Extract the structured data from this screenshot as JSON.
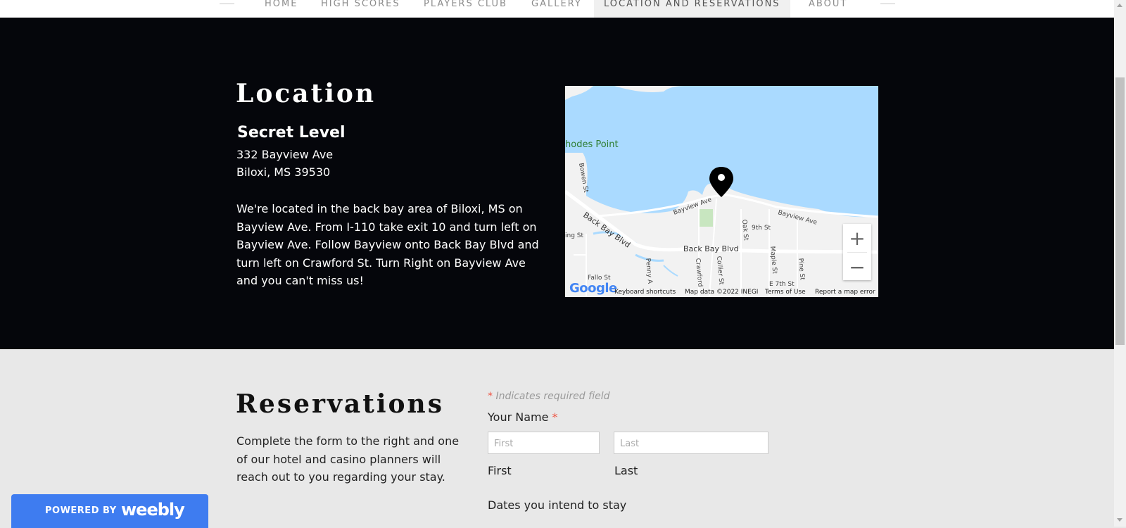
{
  "nav": {
    "items": [
      {
        "label": "HOME"
      },
      {
        "label": "HIGH SCORES"
      },
      {
        "label": "PLAYERS CLUB"
      },
      {
        "label": "GALLERY"
      },
      {
        "label": "LOCATION AND RESERVATIONS",
        "active": true
      },
      {
        "label": "ABOUT"
      }
    ]
  },
  "location": {
    "title": "Location",
    "venue": "Secret Level",
    "address_line1": "332 Bayview Ave",
    "address_line2": "Biloxi, MS 39530",
    "directions": "We're located in the back bay area of Biloxi, MS on Bayview Ave. From I-110 take exit 10 and turn left on Bayview Ave. Follow Bayview onto Back Bay Blvd and turn left on Crawford St. Turn Right on Bayview Ave and you can't miss us!"
  },
  "map": {
    "labels": {
      "rhodes_point": "hodes Point",
      "bowen_st": "Bowen St",
      "bayview_ave_1": "Bayview Ave",
      "bayview_ave_2": "Bayview Ave",
      "oak_st": "Oak St",
      "ninth_st": "9th St",
      "back_bay_blvd_1": "Back Bay Blvd",
      "back_bay_blvd_2": "Back Bay Blvd",
      "ing_st": "ing St",
      "maple_st": "Maple St",
      "pine_st": "Pine St",
      "fallo_st": "Fallo St",
      "penny_a": "Penny A",
      "crawford": "Crawford",
      "collier_st": "Collier St",
      "e7th_st": "E 7th St"
    },
    "zoom_in": "+",
    "zoom_out": "−",
    "google_logo": "Google",
    "attribution": {
      "keyboard": "Keyboard shortcuts",
      "mapdata": "Map data ©2022 INEGI",
      "terms": "Terms of Use",
      "report": "Report a map error"
    },
    "colors": {
      "water": "#aadaff",
      "land": "#f2f2f2",
      "park": "#c8e6c0"
    }
  },
  "reservations": {
    "title": "Reservations",
    "description": "Complete the form to the right and one of our hotel and casino planners will reach out to you regarding your stay.",
    "required_star": "*",
    "required_note": "Indicates required field",
    "name_label": "Your Name",
    "first_placeholder": "First",
    "last_placeholder": "Last",
    "first_label": "First",
    "last_label": "Last",
    "dates_label": "Dates you intend to stay"
  },
  "weebly": {
    "powered_by": "POWERED BY",
    "logo": "weebly",
    "color": "#3e7cf0"
  }
}
